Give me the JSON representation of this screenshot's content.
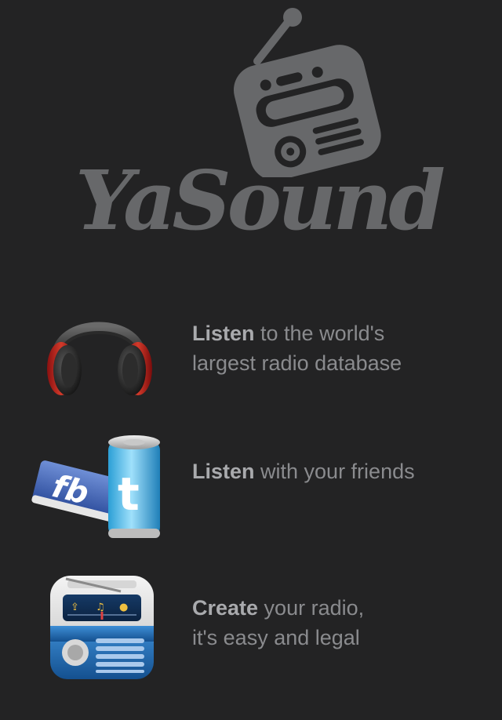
{
  "logo": {
    "wordmark": "YaSound"
  },
  "features": [
    {
      "icon": "headphones-icon",
      "line1_bold": "Listen",
      "line1_rest": " to the world's",
      "line2": "largest radio database"
    },
    {
      "icon": "social-facebook-twitter-icon",
      "line1_bold": "Listen",
      "line1_rest": " with your friends",
      "line2": ""
    },
    {
      "icon": "radio-app-icon",
      "line1_bold": "Create",
      "line1_rest": " your radio,",
      "line2": "it's easy and legal"
    }
  ],
  "colors": {
    "background": "#232324",
    "logo_grey": "#67686a",
    "text_grey": "#8a8b8e",
    "text_bold": "#a9aaad"
  }
}
